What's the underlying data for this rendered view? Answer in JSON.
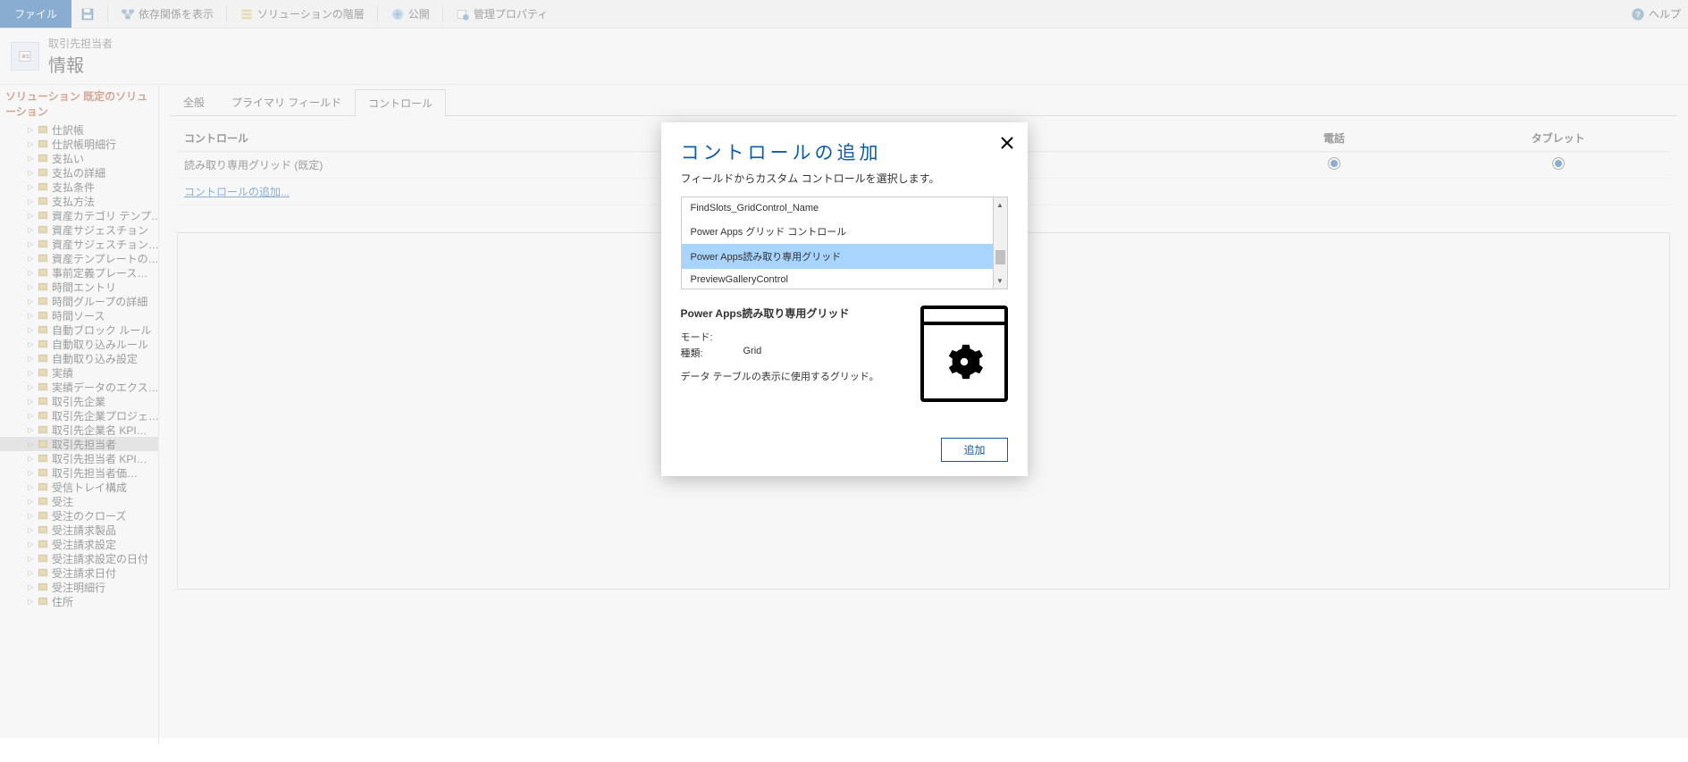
{
  "toolbar": {
    "file": "ファイル",
    "save": "",
    "dependencies": "依存関係を表示",
    "hierarchy": "ソリューションの階層",
    "publish": "公開",
    "mgmt_props": "管理プロパティ",
    "help": "ヘルプ"
  },
  "header": {
    "subtitle": "取引先担当者",
    "title": "情報"
  },
  "solution": {
    "label_prefix": "ソリューション",
    "label_name": "既定のソリューション",
    "items": [
      {
        "label": "仕訳帳"
      },
      {
        "label": "仕訳帳明細行"
      },
      {
        "label": "支払い"
      },
      {
        "label": "支払の詳細"
      },
      {
        "label": "支払条件"
      },
      {
        "label": "支払方法"
      },
      {
        "label": "資産カテゴリ テンプ…"
      },
      {
        "label": "資産サジェスチョン"
      },
      {
        "label": "資産サジェスチョン…"
      },
      {
        "label": "資産テンプレートの…"
      },
      {
        "label": "事前定義プレース…"
      },
      {
        "label": "時間エントリ"
      },
      {
        "label": "時間グループの詳細"
      },
      {
        "label": "時間ソース"
      },
      {
        "label": "自動ブロック ルール"
      },
      {
        "label": "自動取り込みルール"
      },
      {
        "label": "自動取り込み設定"
      },
      {
        "label": "実績"
      },
      {
        "label": "実績データのエクス…"
      },
      {
        "label": "取引先企業"
      },
      {
        "label": "取引先企業プロジェ…"
      },
      {
        "label": "取引先企業名 KPI…"
      },
      {
        "label": "取引先担当者",
        "selected": true
      },
      {
        "label": "取引先担当者 KPI…"
      },
      {
        "label": "取引先担当者価…"
      },
      {
        "label": "受信トレイ構成"
      },
      {
        "label": "受注"
      },
      {
        "label": "受注のクローズ"
      },
      {
        "label": "受注請求製品"
      },
      {
        "label": "受注請求設定"
      },
      {
        "label": "受注請求設定の日付"
      },
      {
        "label": "受注請求日付"
      },
      {
        "label": "受注明細行"
      },
      {
        "label": "住所"
      }
    ]
  },
  "tabs": [
    {
      "label": "全般"
    },
    {
      "label": "プライマリ フィールド"
    },
    {
      "label": "コントロール",
      "active": true
    }
  ],
  "controls_panel": {
    "header_control": "コントロール",
    "header_web": "",
    "header_phone": "電話",
    "header_tablet": "タブレット",
    "row1": "読み取り専用グリッド (既定)",
    "add_link": "コントロールの追加..."
  },
  "dialog": {
    "title": "コントロールの追加",
    "subtitle": "フィールドからカスタム コントロールを選択します。",
    "items": [
      {
        "label": "FindSlots_GridControl_Name"
      },
      {
        "label": "Power Apps グリッド コントロール"
      },
      {
        "label": "Power Apps読み取り専用グリッド",
        "selected": true
      },
      {
        "label": "PreviewGalleryControl"
      }
    ],
    "detail_title": "Power Apps読み取り専用グリッド",
    "mode_k": "モード:",
    "mode_v": "",
    "type_k": "種類:",
    "type_v": "Grid",
    "desc": "データ テーブルの表示に使用するグリッド。",
    "add_btn": "追加"
  }
}
